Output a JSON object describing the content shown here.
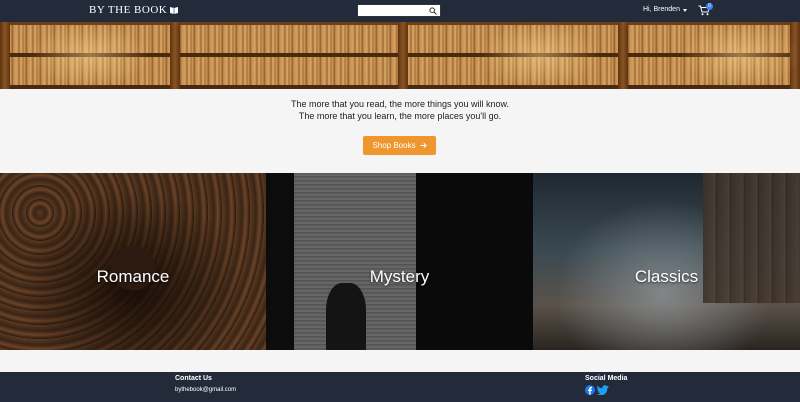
{
  "navbar": {
    "brand": "BY THE BOOK",
    "search": {
      "placeholder": "",
      "value": ""
    },
    "user_greeting": "Hi, Brenden",
    "cart_count": "0"
  },
  "hero": {
    "image": "bookshelf banner"
  },
  "quote": {
    "line1": "The more that you read, the more things you will know.",
    "line2": "The more that you learn, the more places you'll go.",
    "button_label": "Shop Books",
    "button_color": "#f0962e"
  },
  "categories": [
    {
      "label": "Romance"
    },
    {
      "label": "Mystery"
    },
    {
      "label": "Classics"
    }
  ],
  "footer": {
    "contact_heading": "Contact Us",
    "email": "bythebook@gmail.com",
    "social_heading": "Social Media",
    "social_icons": [
      "facebook-icon",
      "twitter-icon"
    ]
  },
  "colors": {
    "navbar": "#232b3b",
    "accent": "#f0962e",
    "badge": "#3b82f6"
  }
}
